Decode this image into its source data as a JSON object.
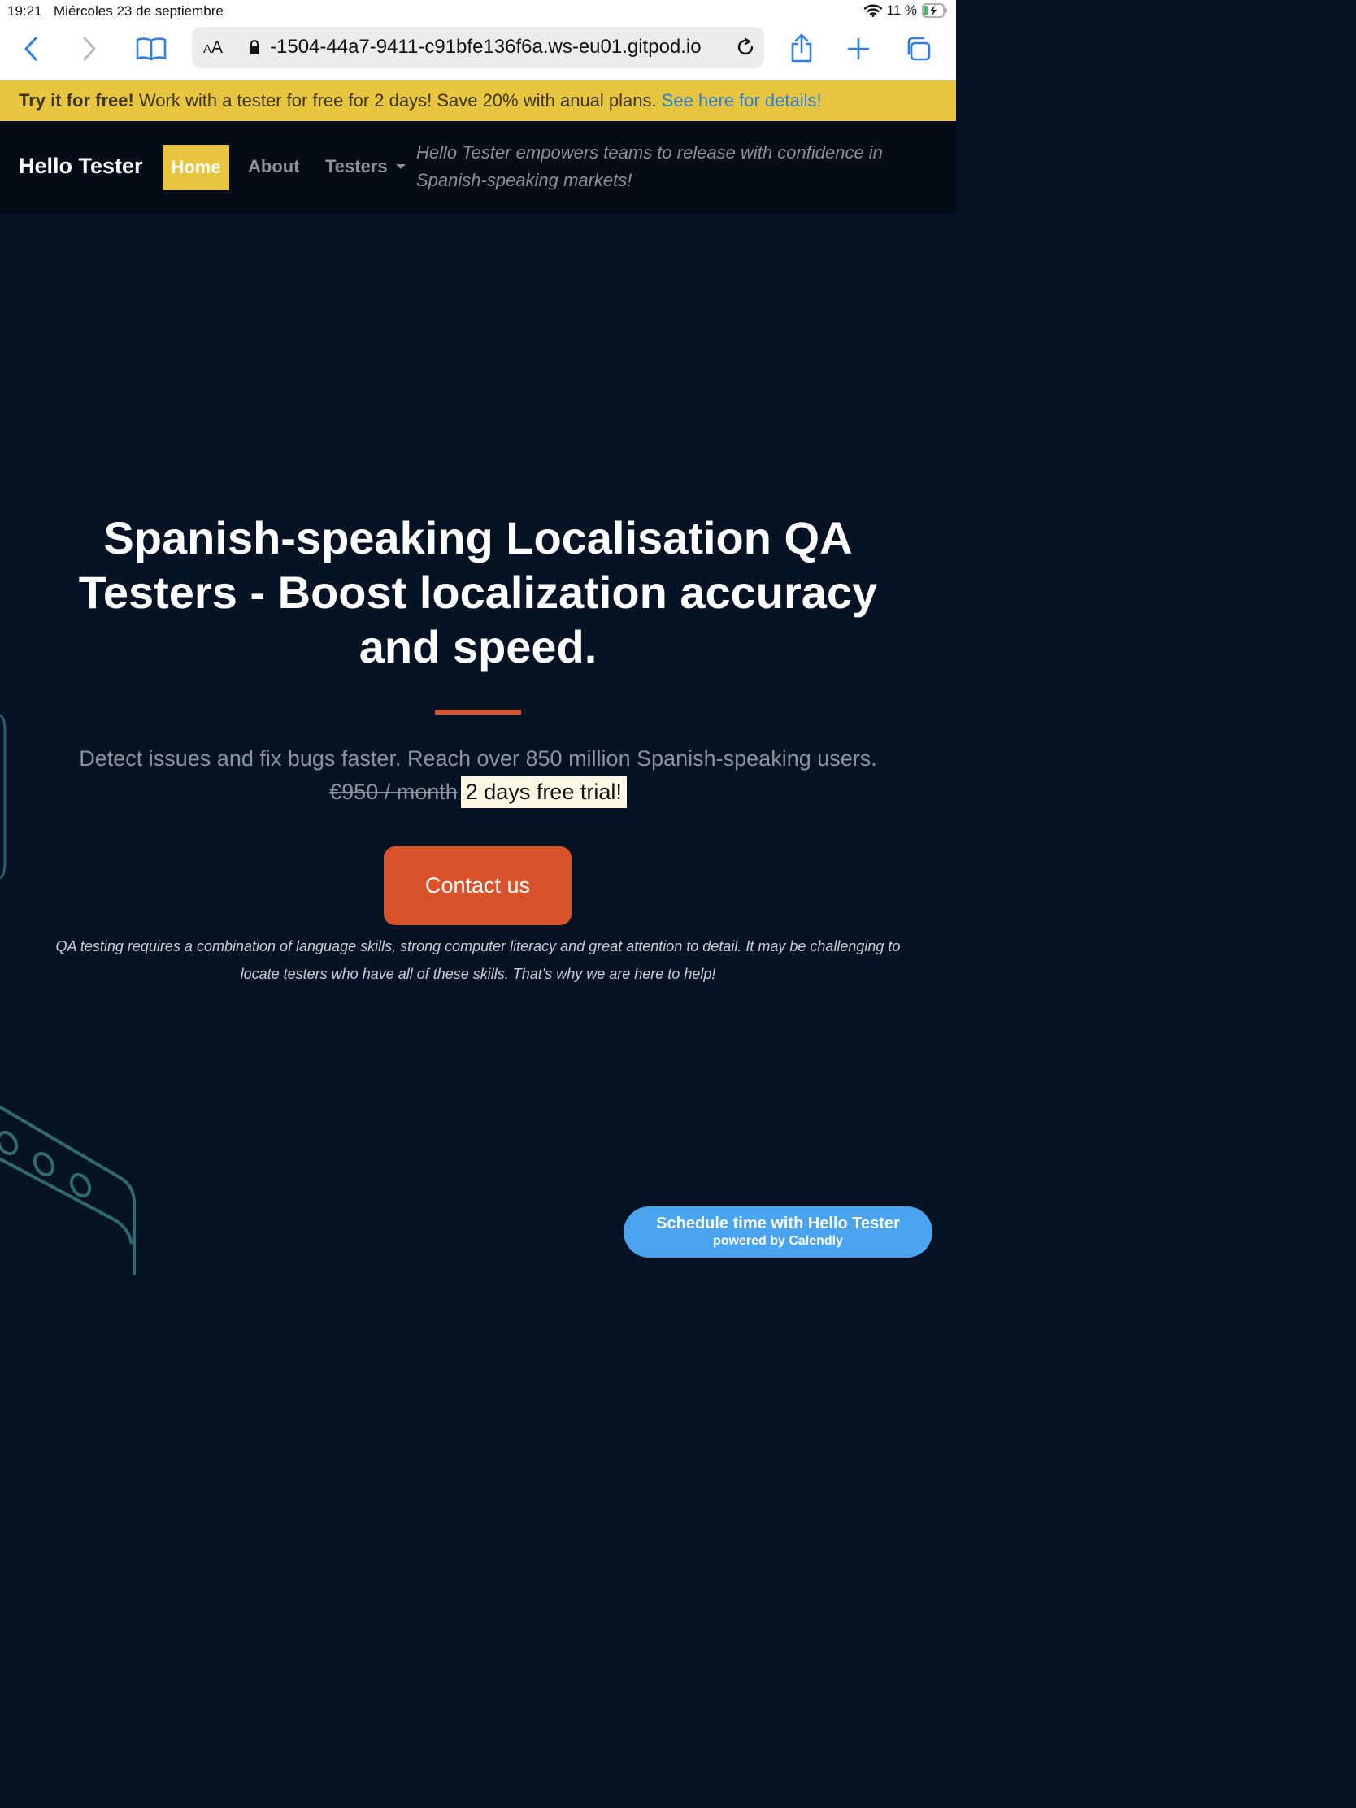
{
  "status_bar": {
    "time": "19:21",
    "date": "Miércoles 23 de septiembre",
    "battery": "11 %"
  },
  "browser": {
    "text_size_small": "A",
    "text_size_large": "A",
    "url": "-1504-44a7-9411-c91bfe136f6a.ws-eu01.gitpod.io",
    "accent_color": "#2f7fe0"
  },
  "promo": {
    "bold": "Try it for free!",
    "text": " Work with a tester for free for 2 days! Save 20% with anual plans. ",
    "link": "See here for details!"
  },
  "nav": {
    "brand": "Hello Tester",
    "items": [
      {
        "label": "Home",
        "active": true
      },
      {
        "label": "About"
      },
      {
        "label": "Testers",
        "dropdown": true
      }
    ],
    "tagline": "Hello Tester empowers teams to release with confidence in Spanish-speaking markets!"
  },
  "hero": {
    "title_line1": "Spanish-speaking Localisation QA",
    "title_line2": "Testers - Boost localization accuracy",
    "title_line3": "and speed.",
    "subtitle": "Detect issues and fix bugs faster. Reach over 850 million Spanish-speaking users.",
    "old_price": "€950 / month",
    "trial": "2 days free trial!",
    "cta": "Contact us",
    "note": "QA testing requires a combination of language skills, strong computer literacy and great attention to detail. It may be challenging to locate testers who have all of these skills. That's why we are here to help!"
  },
  "calendly": {
    "title": "Schedule time with Hello Tester",
    "subtitle": "powered by Calendly"
  },
  "colors": {
    "background": "#061325",
    "yellow": "#e8c53e",
    "orange": "#d9532a",
    "calendly_blue": "#4aa3f0"
  }
}
